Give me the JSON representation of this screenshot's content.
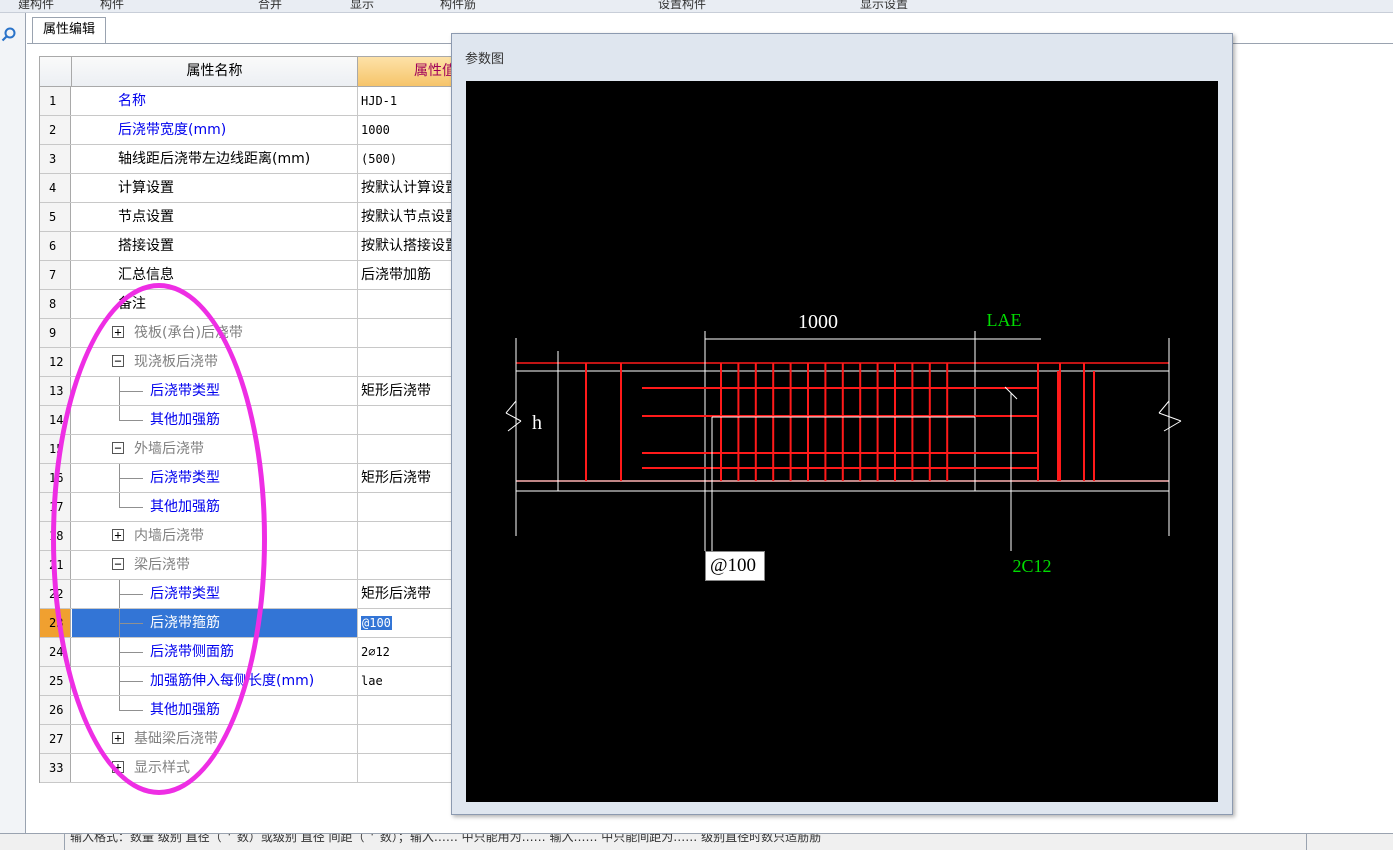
{
  "toolbar": {
    "items": [
      "建构件",
      "构件",
      "合并",
      "显示",
      "构件筋",
      "设置构件",
      "显示设置",
      "显示",
      "显示",
      "显示"
    ]
  },
  "tab": {
    "label": "属性编辑"
  },
  "grid": {
    "header_name": "属性名称",
    "header_value": "属性值",
    "rows": [
      {
        "num": "1",
        "name": "名称",
        "value": "HJD-1"
      },
      {
        "num": "2",
        "name": "后浇带宽度(mm)",
        "value": "1000"
      },
      {
        "num": "3",
        "name": "轴线距后浇带左边线距离(mm)",
        "value": "(500)"
      },
      {
        "num": "4",
        "name": "计算设置",
        "value": "按默认计算设置"
      },
      {
        "num": "5",
        "name": "节点设置",
        "value": "按默认节点设置"
      },
      {
        "num": "6",
        "name": "搭接设置",
        "value": "按默认搭接设置"
      },
      {
        "num": "7",
        "name": "汇总信息",
        "value": "后浇带加筋"
      },
      {
        "num": "8",
        "name": "备注",
        "value": ""
      },
      {
        "num": "9",
        "name": "筏板(承台)后浇带",
        "value": "",
        "expander": "+"
      },
      {
        "num": "12",
        "name": "现浇板后浇带",
        "value": "",
        "expander": "−"
      },
      {
        "num": "13",
        "name": "后浇带类型",
        "value": "矩形后浇带"
      },
      {
        "num": "14",
        "name": "其他加强筋",
        "value": ""
      },
      {
        "num": "15",
        "name": "外墙后浇带",
        "value": "",
        "expander": "−"
      },
      {
        "num": "16",
        "name": "后浇带类型",
        "value": "矩形后浇带"
      },
      {
        "num": "17",
        "name": "其他加强筋",
        "value": ""
      },
      {
        "num": "18",
        "name": "内墙后浇带",
        "value": "",
        "expander": "+"
      },
      {
        "num": "21",
        "name": "梁后浇带",
        "value": "",
        "expander": "−"
      },
      {
        "num": "22",
        "name": "后浇带类型",
        "value": "矩形后浇带"
      },
      {
        "num": "23",
        "name": "后浇带箍筋",
        "value": "@100"
      },
      {
        "num": "24",
        "name": "后浇带侧面筋",
        "value": "2⌀12"
      },
      {
        "num": "25",
        "name": "加强筋伸入每侧长度(mm)",
        "value": "lae"
      },
      {
        "num": "26",
        "name": "其他加强筋",
        "value": ""
      },
      {
        "num": "27",
        "name": "基础梁后浇带",
        "value": "",
        "expander": "+"
      },
      {
        "num": "33",
        "name": "显示样式",
        "value": "",
        "expander": "+"
      }
    ]
  },
  "dialog": {
    "title": "参数图",
    "dim_width": "1000",
    "dim_lae": "LAE",
    "height_label": "h",
    "stirrup_input": "@100",
    "side_bar_label": "2C12"
  },
  "status": {
    "text": "输入格式：数量 级别 直径（`'`数）或级别 直径 间距（`'`数）；输入…… 中只能用为…… 输入…… 中只能间距为…… 级别直径时数只适筋筋"
  },
  "colors": {
    "accent_header": "#f6c46a",
    "selection": "#3375d6",
    "link_blue": "#0000ee",
    "annotation": "#ee2ee4",
    "rebar_red": "#ff1a1a",
    "label_green": "#00cc00"
  }
}
